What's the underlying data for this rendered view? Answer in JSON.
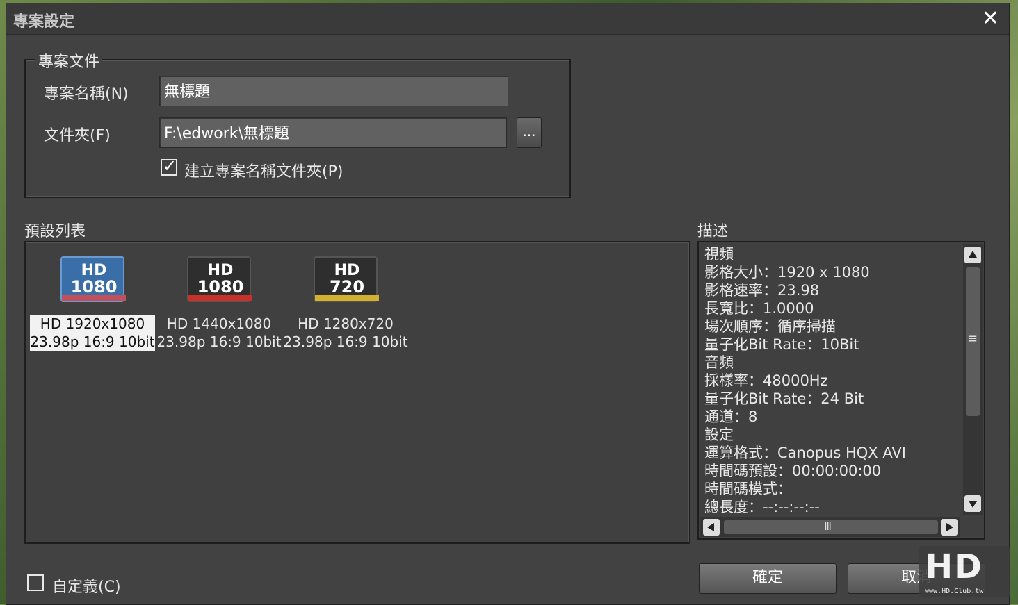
{
  "dialog": {
    "title": "專案設定",
    "close_glyph": "✕"
  },
  "project_doc": {
    "legend": "專案文件",
    "name_label": "專案名稱(N)",
    "name_value": "無標題",
    "folder_label": "文件夾(F)",
    "folder_value": "F:\\edwork\\無標題",
    "browse_label": "...",
    "create_folder_label": "建立專案名稱文件夾(P)",
    "create_folder_checked": true
  },
  "presets": {
    "label": "預設列表",
    "items": [
      {
        "badge_top": "HD",
        "badge_bottom": "1080",
        "line1": "HD 1920x1080",
        "line2": "23.98p 16:9 10bit",
        "stripe": "#c0505a",
        "body": "#3a6ea8",
        "selected": true
      },
      {
        "badge_top": "HD",
        "badge_bottom": "1080",
        "line1": "HD 1440x1080",
        "line2": "23.98p 16:9 10bit",
        "stripe": "#c8302a",
        "body": "#2e2e2e",
        "selected": false
      },
      {
        "badge_top": "HD",
        "badge_bottom": "720",
        "line1": "HD 1280x720",
        "line2": "23.98p 16:9 10bit",
        "stripe": "#d4b030",
        "body": "#2e2e2e",
        "selected": false
      }
    ]
  },
  "description": {
    "label": "描述",
    "lines": [
      "視頻",
      "影格大小：1920 x 1080",
      "影格速率：23.98",
      "長寬比：1.0000",
      "場次順序：循序掃描",
      "量子化Bit Rate：10Bit",
      "音頻",
      "採樣率：48000Hz",
      "量子化Bit Rate：24 Bit",
      "通道：8",
      "設定",
      "運算格式：Canopus HQX AVI",
      "時間碼預設：00:00:00:00",
      "時間碼模式：",
      "總長度：--:--:--:--"
    ],
    "scroll_glyph": "≡",
    "hscroll_glyph": "Ⅲ"
  },
  "custom": {
    "label": "自定義(C)",
    "checked": false
  },
  "buttons": {
    "ok": "確定",
    "cancel": "取消"
  },
  "watermark": {
    "logo": "HD",
    "url": "www.HD.Club.tw"
  }
}
